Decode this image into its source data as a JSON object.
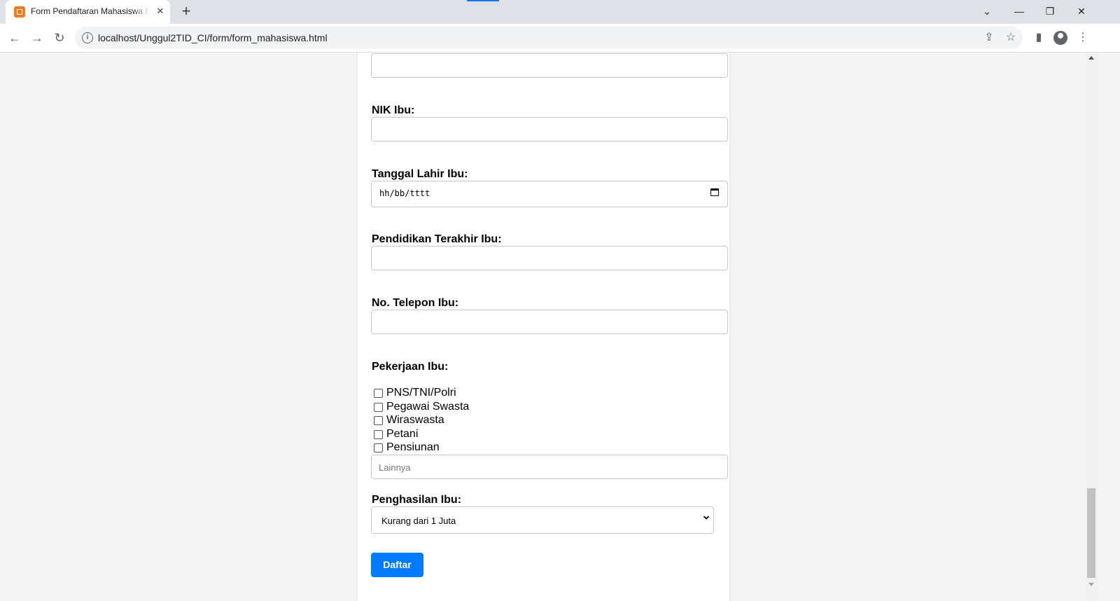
{
  "browser": {
    "tab_title": "Form Pendaftaran Mahasiswa Baru",
    "tab_close": "✕",
    "new_tab": "+",
    "url": "localhost/Unggul2TID_CI/form/form_mahasiswa.html",
    "window_controls": {
      "tab_search": "⌄",
      "minimize": "—",
      "restore": "❐",
      "close": "✕"
    },
    "accent": "#1a73e8"
  },
  "form": {
    "nik_ibu_label": "NIK Ibu:",
    "tanggal_lahir_ibu_label": "Tanggal Lahir Ibu:",
    "tanggal_lahir_ibu_placeholder": "hh/bb/tttt",
    "pendidikan_ibu_label": "Pendidikan Terakhir Ibu:",
    "telepon_ibu_label": "No. Telepon Ibu:",
    "pekerjaan_ibu_label": "Pekerjaan Ibu:",
    "pekerjaan_options": [
      {
        "label": "PNS/TNI/Polri",
        "checked": false
      },
      {
        "label": "Pegawai Swasta",
        "checked": false
      },
      {
        "label": "Wiraswasta",
        "checked": false
      },
      {
        "label": "Petani",
        "checked": false
      },
      {
        "label": "Pensiunan",
        "checked": false
      }
    ],
    "lainnya_placeholder": "Lainnya",
    "penghasilan_ibu_label": "Penghasilan Ibu:",
    "penghasilan_ibu_value": "Kurang dari 1 Juta",
    "submit_label": "Daftar",
    "submit_color": "#007bff"
  }
}
